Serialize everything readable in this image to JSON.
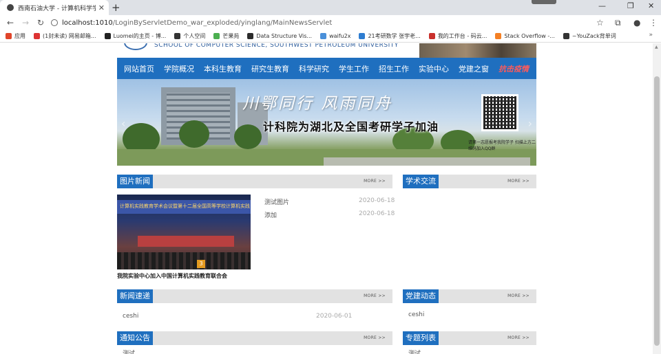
{
  "browser": {
    "tab_title": "西南石油大学 - 计算机科学学院",
    "tab_close": "✕",
    "new_tab": "+",
    "url_host": "localhost:1010",
    "url_path": "/LoginByServletDemo_war_exploded/yinglang/MainNewsServlet",
    "window_controls": [
      "—",
      "❐",
      "✕"
    ],
    "toolbar_icons": [
      "star-icon",
      "extension-icon",
      "account-icon",
      "menu-icon"
    ]
  },
  "bookmarks": {
    "items": [
      {
        "label": "应用",
        "color": "#e0452a"
      },
      {
        "label": "(1封未读) 网易邮箱...",
        "color": "#d33"
      },
      {
        "label": "Luomei的主页 - 博...",
        "color": "#222"
      },
      {
        "label": "个人空间",
        "color": "#333"
      },
      {
        "label": "芒果苑",
        "color": "#4caf50"
      },
      {
        "label": "Data Structure Vis...",
        "color": "#2b2b2b"
      },
      {
        "label": "waifu2x",
        "color": "#4a90d9"
      },
      {
        "label": "21考研数学 张宇老...",
        "color": "#2e7dd1"
      },
      {
        "label": "我的工作台 - 码云...",
        "color": "#c9302c"
      },
      {
        "label": "Stack Overflow -...",
        "color": "#f48024"
      },
      {
        "label": "~YouZack背单词",
        "color": "#333"
      }
    ],
    "more": "»"
  },
  "site": {
    "school_en": "SCHOOL OF COMPUTER SCIENCE, SOUTHWEST PETROLEUM UNIVERSITY",
    "nav": [
      "网站首页",
      "学院概况",
      "本科生教育",
      "研究生教育",
      "科学研究",
      "学生工作",
      "招生工作",
      "实验中心",
      "党建之窗",
      "抗击疫情"
    ],
    "banner": {
      "slogan_top": "川鄂同行 风雨同舟",
      "slogan_bottom": "计科院为湖北及全国考研学子加油",
      "qr_caption": "请第一志愿报考我院学子 扫描上方二维码加入QQ群"
    },
    "more_label": "MORE >>",
    "sections": {
      "photo_news": {
        "title": "图片新闻",
        "screen_text": "计算机实践教育学术会议暨第十二届全国高等学校计算机实践",
        "photo_number": "3",
        "caption": "我院实验中心加入中国计算机实践教育联合会",
        "items": [
          {
            "title": "测试图片",
            "date": "2020-06-18"
          },
          {
            "title": "添加",
            "date": "2020-06-18"
          }
        ]
      },
      "academic": {
        "title": "学术交流"
      },
      "news_flash": {
        "title": "新闻速递",
        "items": [
          {
            "title": "ceshi",
            "date": "2020-06-01"
          }
        ]
      },
      "party": {
        "title": "党建动态",
        "items": [
          {
            "title": "ceshi"
          }
        ]
      },
      "notice": {
        "title": "通知公告",
        "items": [
          {
            "title": "测试"
          }
        ]
      },
      "topics": {
        "title": "专题列表",
        "items": [
          {
            "title": "测试"
          }
        ]
      }
    }
  }
}
